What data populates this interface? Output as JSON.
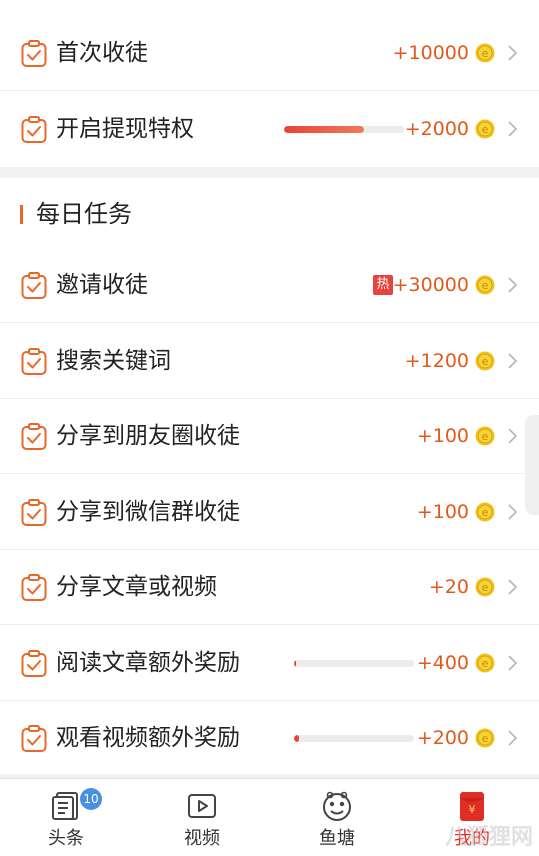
{
  "colors": {
    "accent": "#e05a1c",
    "progress_fill": "#e8433a",
    "hot": "#e8433a",
    "tab_badge": "#4a90e2"
  },
  "top_tasks": [
    {
      "label": "首次收徒",
      "reward": "+10000"
    },
    {
      "label": "开启提现特权",
      "reward": "+2000",
      "progress": 0.67
    }
  ],
  "daily_section": {
    "title": "每日任务"
  },
  "daily_tasks": [
    {
      "label": "邀请收徒",
      "reward": "+30000",
      "badge": "热"
    },
    {
      "label": "搜索关键词",
      "reward": "+1200"
    },
    {
      "label": "分享到朋友圈收徒",
      "reward": "+100"
    },
    {
      "label": "分享到微信群收徒",
      "reward": "+100"
    },
    {
      "label": "分享文章或视频",
      "reward": "+20"
    },
    {
      "label": "阅读文章额外奖励",
      "reward": "+400",
      "progress": 0.01
    },
    {
      "label": "观看视频额外奖励",
      "reward": "+200",
      "progress": 0.04
    }
  ],
  "tabbar": {
    "items": [
      {
        "label": "头条",
        "icon": "news-icon",
        "badge": "10"
      },
      {
        "label": "视频",
        "icon": "video-icon"
      },
      {
        "label": "鱼塘",
        "icon": "pond-icon"
      },
      {
        "label": "我的",
        "icon": "red-envelope-icon",
        "envelope_symbol": "¥"
      }
    ]
  },
  "watermark": "八狐狸网"
}
